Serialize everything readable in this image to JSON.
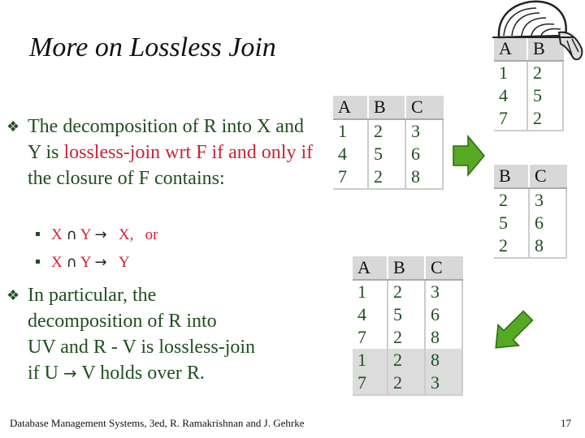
{
  "title": "More on Lossless Join",
  "bullets": {
    "b1": {
      "part1": "The decomposition of R into X and Y is ",
      "part2": "lossless-join wrt F if and only if",
      "part3": " the closure of F contains:"
    },
    "sub1": {
      "x": "X",
      "cap": "∩",
      "y": "Y",
      "arrow": "→",
      "rhs": "X,",
      "tail": "or"
    },
    "sub2": {
      "x": "X",
      "cap": "∩",
      "y": "Y",
      "arrow": "→",
      "rhs": "Y"
    },
    "b2": {
      "line1": "In particular, the",
      "line2": "decomposition of R into",
      "line3": "UV and R - V is lossless-join",
      "line4_pre": "if  U ",
      "line4_arrow": "→",
      "line4_post": " V  holds over R."
    }
  },
  "tables": {
    "r": {
      "headers": [
        "A",
        "B",
        "C"
      ],
      "rows": [
        [
          "1",
          "2",
          "3"
        ],
        [
          "4",
          "5",
          "6"
        ],
        [
          "7",
          "2",
          "8"
        ]
      ]
    },
    "ab": {
      "headers": [
        "A",
        "B"
      ],
      "rows": [
        [
          "1",
          "2"
        ],
        [
          "4",
          "5"
        ],
        [
          "7",
          "2"
        ]
      ]
    },
    "bc": {
      "headers": [
        "B",
        "C"
      ],
      "rows": [
        [
          "2",
          "3"
        ],
        [
          "5",
          "6"
        ],
        [
          "2",
          "8"
        ]
      ]
    },
    "join": {
      "headers": [
        "A",
        "B",
        "C"
      ],
      "rows": [
        [
          "1",
          "2",
          "3"
        ],
        [
          "4",
          "5",
          "6"
        ],
        [
          "7",
          "2",
          "8"
        ],
        [
          "1",
          "2",
          "8"
        ],
        [
          "7",
          "2",
          "3"
        ]
      ]
    }
  },
  "colors": {
    "green_text": "#1f4f1f",
    "red_text": "#cc2233",
    "arrow_green": "#55aa22"
  },
  "footer": "Database Management Systems, 3ed, R. Ramakrishnan and J. Gehrke",
  "page_number": "17"
}
